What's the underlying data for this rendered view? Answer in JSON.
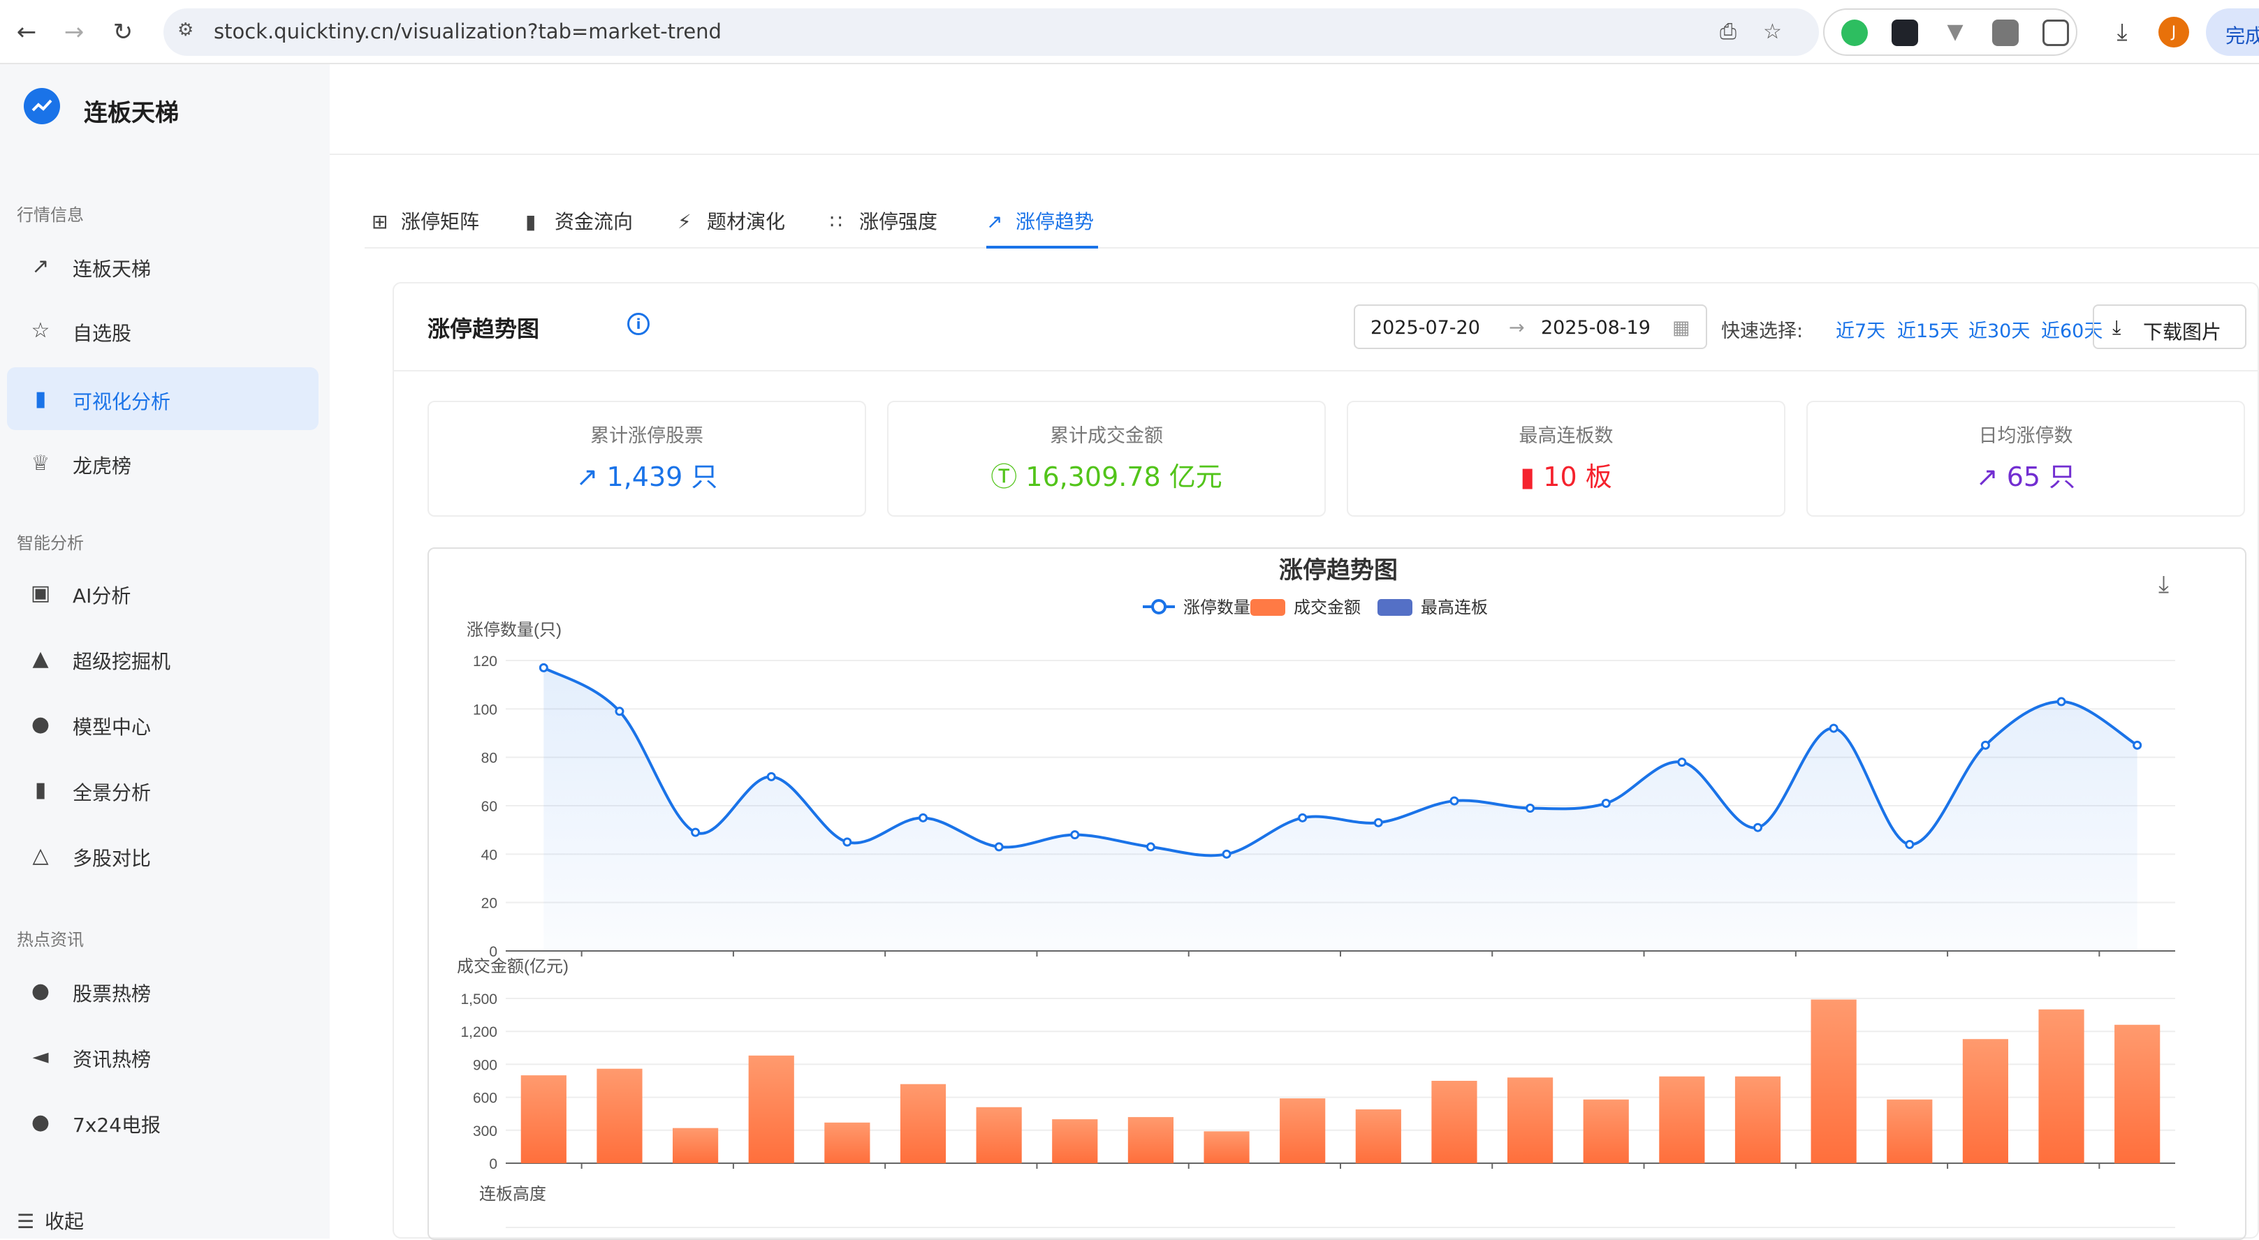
{
  "browser": {
    "url": "stock.quicktiny.cn/visualization?tab=market-trend",
    "avatar_letter": "J",
    "done_label": "完成"
  },
  "sidebar": {
    "logo_text": "连板天梯",
    "sections": [
      {
        "label": "行情信息",
        "items": [
          {
            "label": "连板天梯",
            "icon": "line-chart-icon"
          },
          {
            "label": "自选股",
            "icon": "star-icon"
          },
          {
            "label": "可视化分析",
            "icon": "bar-chart-icon",
            "active": true
          },
          {
            "label": "龙虎榜",
            "icon": "trophy-icon"
          }
        ]
      },
      {
        "label": "智能分析",
        "items": [
          {
            "label": "AI分析",
            "icon": "robot-icon"
          },
          {
            "label": "超级挖掘机",
            "icon": "rocket-icon"
          },
          {
            "label": "模型中心",
            "icon": "fire-icon"
          },
          {
            "label": "全景分析",
            "icon": "bar-chart-icon"
          },
          {
            "label": "多股对比",
            "icon": "flask-icon"
          }
        ]
      },
      {
        "label": "热点资讯",
        "items": [
          {
            "label": "股票热榜",
            "icon": "fire-icon"
          },
          {
            "label": "资讯热榜",
            "icon": "megaphone-icon"
          },
          {
            "label": "7x24电报",
            "icon": "fire-icon"
          }
        ]
      }
    ],
    "collapse_label": "收起"
  },
  "tabs": [
    {
      "label": "涨停矩阵",
      "icon": "grid-icon"
    },
    {
      "label": "资金流向",
      "icon": "bar-chart-icon"
    },
    {
      "label": "题材演化",
      "icon": "lightning-icon"
    },
    {
      "label": "涨停强度",
      "icon": "scatter-icon"
    },
    {
      "label": "涨停趋势",
      "icon": "line-chart-icon",
      "active": true
    }
  ],
  "panel": {
    "title": "涨停趋势图",
    "date_start": "2025-07-20",
    "date_end": "2025-08-19",
    "quick_label": "快速选择:",
    "quick_options": [
      "近7天",
      "近15天",
      "近30天",
      "近60天"
    ],
    "download_label": "下载图片"
  },
  "stats": [
    {
      "label": "累计涨停股票",
      "value": "1,439 只",
      "icon": "trend-up-icon",
      "color": "#1a73e8"
    },
    {
      "label": "累计成交金额",
      "value": "16,309.78 亿元",
      "icon": "dollar-icon",
      "color": "#52c41a"
    },
    {
      "label": "最高连板数",
      "value": "10 板",
      "icon": "bar-chart-icon",
      "color": "#f5222d"
    },
    {
      "label": "日均涨停数",
      "value": "65 只",
      "icon": "trend-up-icon",
      "color": "#722ed1"
    }
  ],
  "chart_data": {
    "type": "line",
    "title": "涨停趋势图",
    "legend": [
      "涨停数量",
      "成交金额",
      "最高连板"
    ],
    "colors": {
      "limit_up": "#1a73e8",
      "amount": "#ff7a45",
      "board": "#5470c6"
    },
    "series": [
      {
        "name": "涨停数量",
        "ylabel": "涨停数量(只)",
        "ylim": [
          0,
          120
        ],
        "ticks": [
          0,
          20,
          40,
          60,
          80,
          100,
          120
        ],
        "values": [
          117,
          99,
          49,
          72,
          45,
          55,
          43,
          48,
          43,
          40,
          55,
          53,
          62,
          59,
          61,
          78,
          51,
          92,
          44,
          85,
          103,
          85
        ]
      },
      {
        "name": "成交金额",
        "type": "bar",
        "ylabel": "成交金额(亿元)",
        "ylim": [
          0,
          1500
        ],
        "ticks": [
          "0",
          "300",
          "600",
          "900",
          "1,200",
          "1,500"
        ],
        "values": [
          800,
          860,
          320,
          980,
          370,
          720,
          510,
          400,
          420,
          290,
          590,
          490,
          750,
          780,
          580,
          790,
          790,
          1490,
          580,
          1130,
          1400,
          1260
        ]
      }
    ],
    "third_axis_label": "连板高度"
  }
}
